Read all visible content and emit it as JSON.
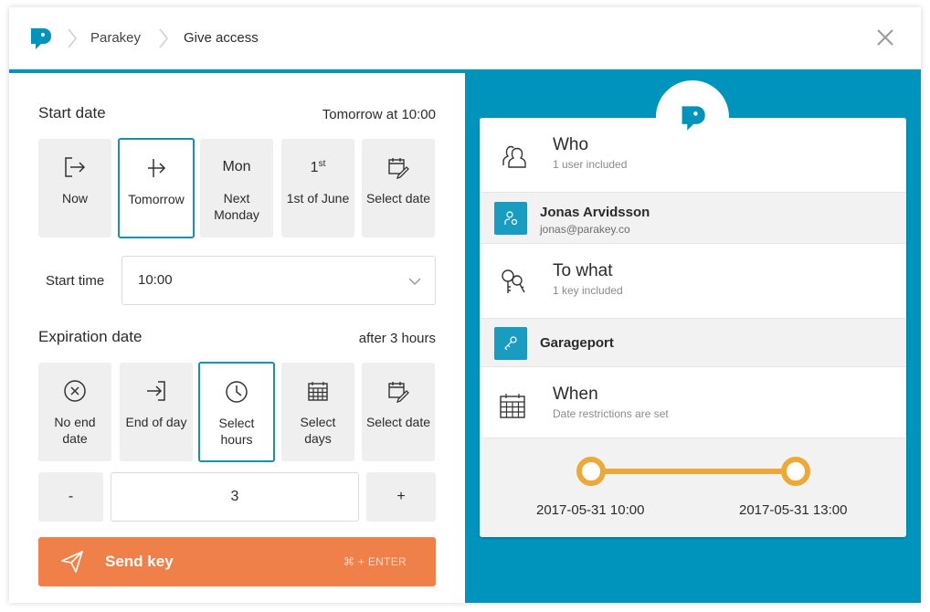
{
  "header": {
    "breadcrumb": [
      "Parakey",
      "Give access"
    ],
    "close_icon": "close-icon"
  },
  "start": {
    "title": "Start date",
    "summary": "Tomorrow at 10:00",
    "options": [
      {
        "icon": "exit-icon",
        "label": "Now"
      },
      {
        "icon": "divider-arrow-icon",
        "label": "Tomorrow",
        "selected": true
      },
      {
        "top": "Mon",
        "label": "Next Monday"
      },
      {
        "top": "1",
        "top_sup": "st",
        "label": "1st of June"
      },
      {
        "icon": "calendar-edit-icon",
        "label": "Select date"
      }
    ],
    "time_label": "Start time",
    "time_value": "10:00"
  },
  "expiration": {
    "title": "Expiration date",
    "summary": "after 3 hours",
    "options": [
      {
        "icon": "circle-x-icon",
        "label": "No end date"
      },
      {
        "icon": "enter-icon",
        "label": "End of day"
      },
      {
        "icon": "clock-icon",
        "label": "Select hours",
        "selected": true
      },
      {
        "icon": "calendar-grid-icon",
        "label": "Select days"
      },
      {
        "icon": "calendar-edit-icon",
        "label": "Select date"
      }
    ],
    "minus": "-",
    "value": "3",
    "plus": "+"
  },
  "send": {
    "label": "Send key",
    "shortcut": "⌘ + ENTER"
  },
  "summary": {
    "who": {
      "title": "Who",
      "sub": "1 user included"
    },
    "user": {
      "name": "Jonas Arvidsson",
      "email": "jonas@parakey.co"
    },
    "what": {
      "title": "To what",
      "sub": "1 key included"
    },
    "key": {
      "name": "Garageport"
    },
    "when": {
      "title": "When",
      "sub": "Date restrictions are set"
    },
    "timeline": {
      "start": "2017-05-31 10:00",
      "end": "2017-05-31 13:00"
    }
  },
  "colors": {
    "accent_blue": "#0094bd",
    "selected_border": "#1a8fa8",
    "send_orange": "#f08049",
    "timeline_yellow": "#eca93a"
  }
}
